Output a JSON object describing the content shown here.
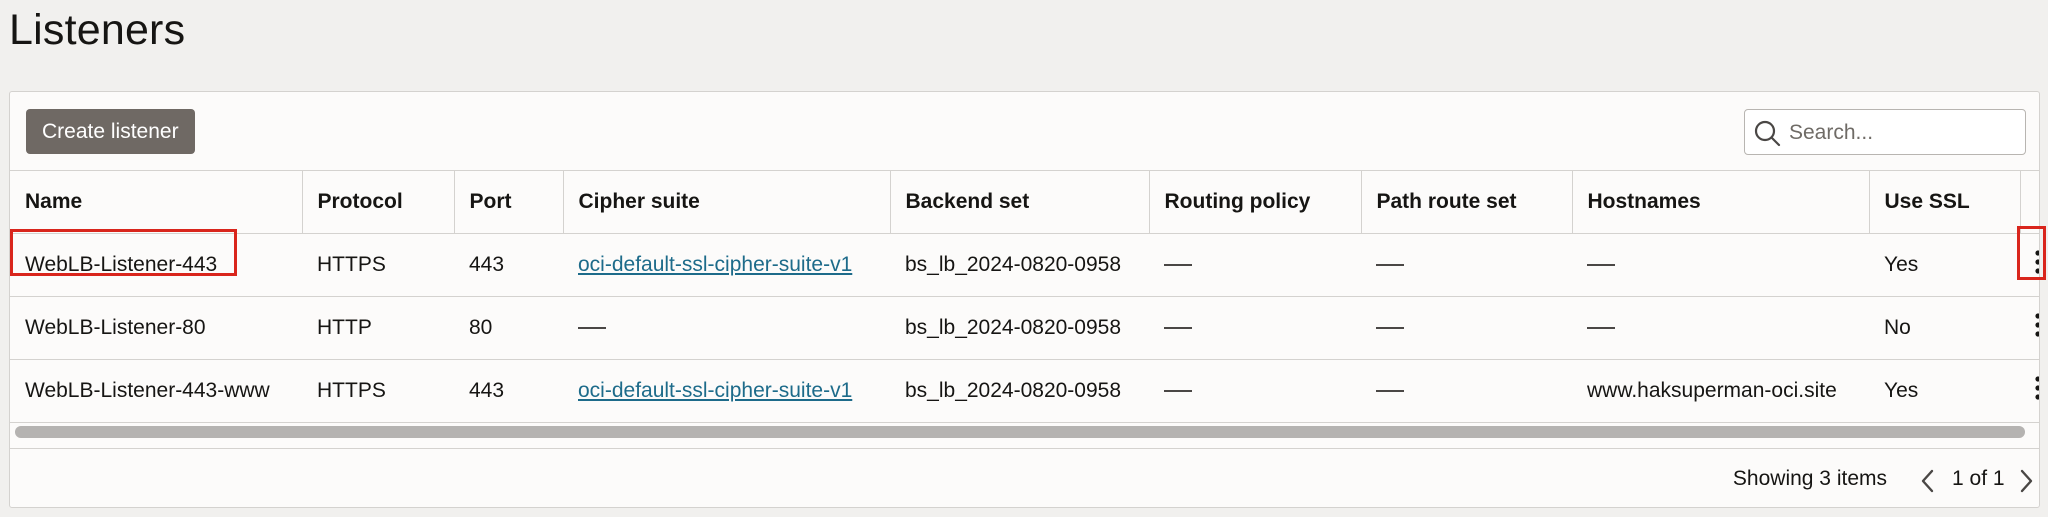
{
  "page": {
    "title": "Listeners"
  },
  "toolbar": {
    "create_label": "Create listener",
    "search_placeholder": "Search..."
  },
  "table": {
    "columns": [
      "Name",
      "Protocol",
      "Port",
      "Cipher suite",
      "Backend set",
      "Routing policy",
      "Path route set",
      "Hostnames",
      "Use SSL"
    ],
    "rows": [
      {
        "name": "WebLB-Listener-443",
        "protocol": "HTTPS",
        "port": "443",
        "cipher_suite": "oci-default-ssl-cipher-suite-v1",
        "backend_set": "bs_lb_2024-0820-0958",
        "routing_policy": "—",
        "path_route_set": "—",
        "hostnames": "—",
        "use_ssl": "Yes"
      },
      {
        "name": "WebLB-Listener-80",
        "protocol": "HTTP",
        "port": "80",
        "cipher_suite": "—",
        "backend_set": "bs_lb_2024-0820-0958",
        "routing_policy": "—",
        "path_route_set": "—",
        "hostnames": "—",
        "use_ssl": "No"
      },
      {
        "name": "WebLB-Listener-443-www",
        "protocol": "HTTPS",
        "port": "443",
        "cipher_suite": "oci-default-ssl-cipher-suite-v1",
        "backend_set": "bs_lb_2024-0820-0958",
        "routing_policy": "—",
        "path_route_set": "—",
        "hostnames": "www.haksuperman-oci.site",
        "use_ssl": "Yes"
      }
    ]
  },
  "footer": {
    "count_text": "Showing 3 items",
    "page_text": "1 of 1"
  },
  "icons": {
    "search": "search-icon",
    "row_actions": "kebab-menu-icon",
    "prev": "chevron-left-icon",
    "next": "chevron-right-icon"
  },
  "colors": {
    "highlight": "#d9251c",
    "link": "#1d6b8a",
    "button": "#6f6964"
  }
}
